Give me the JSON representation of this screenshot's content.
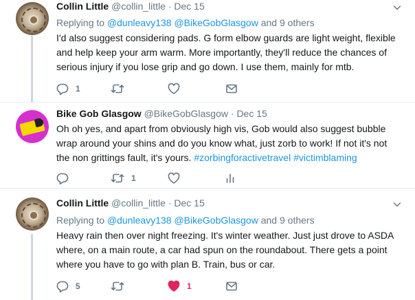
{
  "tweets": [
    {
      "name": "Collin Little",
      "handle": "@collin_little",
      "dot": "·",
      "date": "Dec 15",
      "replying_prefix": "Replying to",
      "replying_user1": "@dunleavy138",
      "replying_user2": "@BikeGobGlasgow",
      "replying_suffix": "and 9 others",
      "lines": [
        "I'd also suggest considering pads. G form elbow guards are light weight, flexible",
        "and help keep your arm warm. More importantly, they'll reduce the chances of",
        "serious injury if you lose grip and go down. I use them, mainly for mtb."
      ],
      "reply_count": "1",
      "retweet_count": "",
      "like_count": ""
    },
    {
      "name": "Bike Gob Glasgow",
      "handle": "@BikeGobGlasgow",
      "dot": "·",
      "date": "Dec 15",
      "lines": [
        "Oh oh yes, and apart from obviously high vis, Gob would also suggest bubble",
        "wrap around your shins and do you know what, just zorb to work! If not it's not",
        "the non grittings fault, it's yours."
      ],
      "hashtag1": "#zorbingforactivetravel",
      "hashtag2": "#victimblaming",
      "reply_count": "",
      "retweet_count": "1",
      "like_count": ""
    },
    {
      "name": "Collin Little",
      "handle": "@collin_little",
      "dot": "·",
      "date": "Dec 15",
      "replying_prefix": "Replying to",
      "replying_user1": "@dunleavy138",
      "replying_user2": "@BikeGobGlasgow",
      "replying_suffix": "and 9 others",
      "lines": [
        "Heavy rain then over night freezing. It's winter weather. Just just drove to ASDA",
        "where, on a main route, a car had spun on the roundabout. There gets a point",
        "where you have to go with plan B. Train, bus or car."
      ],
      "reply_count": "5",
      "retweet_count": "",
      "like_count": "1"
    }
  ],
  "colors": {
    "link": "#1b95e0",
    "muted": "#657786",
    "like": "#e0245e",
    "thread_line": "#ccd6dd"
  },
  "icons": [
    "reply-icon",
    "retweet-icon",
    "like-icon",
    "message-icon",
    "analytics-icon",
    "chevron-down-icon"
  ]
}
